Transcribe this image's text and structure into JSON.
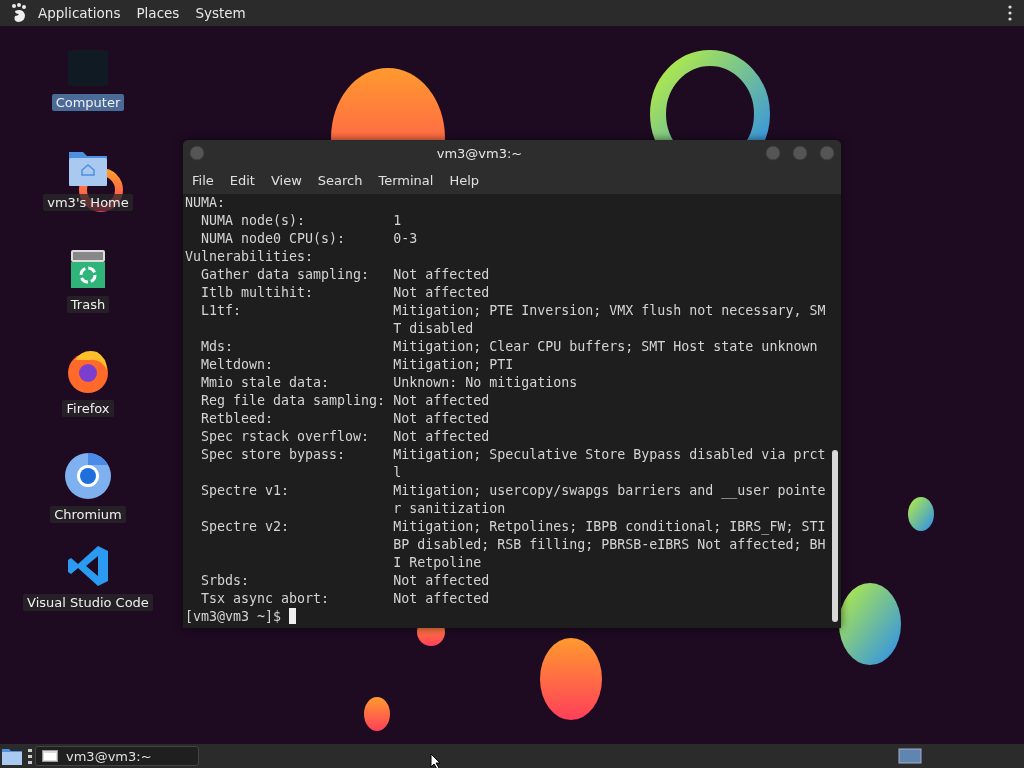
{
  "top_panel": {
    "menus": [
      "Applications",
      "Places",
      "System"
    ]
  },
  "desktop_icons": [
    {
      "kind": "computer",
      "label": "Computer",
      "selected": true
    },
    {
      "kind": "home",
      "label": "vm3's Home",
      "selected": false
    },
    {
      "kind": "trash",
      "label": "Trash",
      "selected": false
    },
    {
      "kind": "firefox",
      "label": "Firefox",
      "selected": false
    },
    {
      "kind": "chromium",
      "label": "Chromium",
      "selected": false
    },
    {
      "kind": "vscode",
      "label": "Visual Studio Code",
      "selected": false
    }
  ],
  "terminal": {
    "title": "vm3@vm3:~",
    "menu": [
      "File",
      "Edit",
      "View",
      "Search",
      "Terminal",
      "Help"
    ],
    "lines": [
      {
        "kind": "heading",
        "text": "NUMA:"
      },
      {
        "kind": "entry",
        "label": "NUMA node(s):",
        "values": [
          "1"
        ]
      },
      {
        "kind": "entry",
        "label": "NUMA node0 CPU(s):",
        "values": [
          "0-3"
        ]
      },
      {
        "kind": "heading",
        "text": "Vulnerabilities:"
      },
      {
        "kind": "entry",
        "label": "Gather data sampling:",
        "values": [
          "Not affected"
        ]
      },
      {
        "kind": "entry",
        "label": "Itlb multihit:",
        "values": [
          "Not affected"
        ]
      },
      {
        "kind": "entry",
        "label": "L1tf:",
        "values": [
          "Mitigation; PTE Inversion; VMX flush not necessary, SM",
          "T disabled"
        ]
      },
      {
        "kind": "entry",
        "label": "Mds:",
        "values": [
          "Mitigation; Clear CPU buffers; SMT Host state unknown"
        ]
      },
      {
        "kind": "entry",
        "label": "Meltdown:",
        "values": [
          "Mitigation; PTI"
        ]
      },
      {
        "kind": "entry",
        "label": "Mmio stale data:",
        "values": [
          "Unknown: No mitigations"
        ]
      },
      {
        "kind": "entry",
        "label": "Reg file data sampling:",
        "values": [
          "Not affected"
        ]
      },
      {
        "kind": "entry",
        "label": "Retbleed:",
        "values": [
          "Not affected"
        ]
      },
      {
        "kind": "entry",
        "label": "Spec rstack overflow:",
        "values": [
          "Not affected"
        ]
      },
      {
        "kind": "entry",
        "label": "Spec store bypass:",
        "values": [
          "Mitigation; Speculative Store Bypass disabled via prct",
          "l"
        ]
      },
      {
        "kind": "entry",
        "label": "Spectre v1:",
        "values": [
          "Mitigation; usercopy/swapgs barriers and __user pointe",
          "r sanitization"
        ]
      },
      {
        "kind": "entry",
        "label": "Spectre v2:",
        "values": [
          "Mitigation; Retpolines; IBPB conditional; IBRS_FW; STI",
          "BP disabled; RSB filling; PBRSB-eIBRS Not affected; BH",
          "I Retpoline"
        ]
      },
      {
        "kind": "entry",
        "label": "Srbds:",
        "values": [
          "Not affected"
        ]
      },
      {
        "kind": "entry",
        "label": "Tsx async abort:",
        "values": [
          "Not affected"
        ]
      }
    ],
    "prompt": "[vm3@vm3 ~]$"
  },
  "taskbar": {
    "tasks": [
      {
        "label": "vm3@vm3:~",
        "selected": false
      }
    ]
  }
}
